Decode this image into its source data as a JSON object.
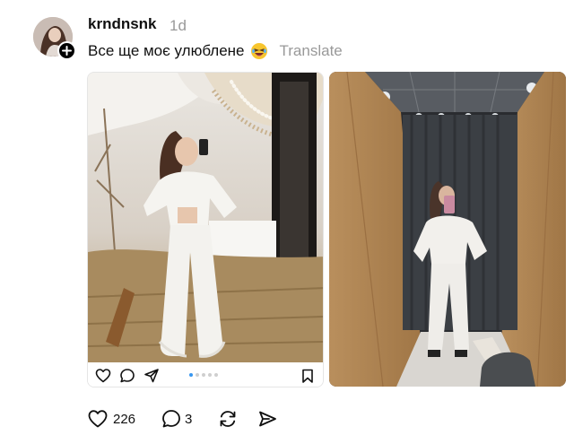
{
  "post": {
    "username": "krndnsnk",
    "time": "1d",
    "caption": "Все ще моє улюблене",
    "translate_label": "Translate"
  },
  "icons": {
    "avatar": "avatar-photo",
    "follow": "plus-icon",
    "emoji": "grinning-squinting-face-emoji",
    "like": "heart-icon",
    "comment": "comment-icon",
    "repost": "repost-icon",
    "share": "send-icon",
    "bookmark": "bookmark-icon"
  },
  "carousel": {
    "pages": 5,
    "active_page": 1
  },
  "stats": {
    "likes": "226",
    "comments": "3"
  },
  "colors": {
    "text": "#101010",
    "secondary": "#999999",
    "dot_active": "#3897f0"
  }
}
